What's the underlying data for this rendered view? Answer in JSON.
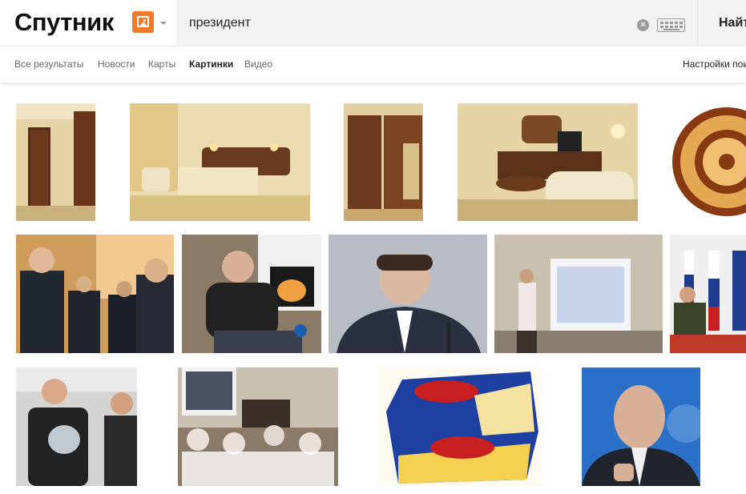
{
  "header": {
    "logo_text": "Спутник",
    "search_value": "президент",
    "search_button_label": "Найти",
    "clear_symbol": "×"
  },
  "nav": {
    "items": [
      "Все результаты",
      "Новости",
      "Карты",
      "Картинки",
      "Видео"
    ],
    "active_index": 3,
    "settings_label": "Настройки поиска"
  },
  "results": {
    "rows": [
      [
        {
          "subject": "hotel-room-door",
          "colors": [
            "#e8d8b0",
            "#5a2e18",
            "#c9b080"
          ]
        },
        {
          "subject": "hotel-bedroom",
          "colors": [
            "#efe0b8",
            "#6a3a20",
            "#e6d6a8"
          ]
        },
        {
          "subject": "wardrobe",
          "colors": [
            "#e2cfa0",
            "#6b3a1c",
            "#d8c08a"
          ]
        },
        {
          "subject": "hotel-living-room",
          "colors": [
            "#e8d8a8",
            "#5c3218",
            "#f0e6cc"
          ]
        },
        {
          "subject": "ornamental-rosette",
          "colors": [
            "#ffffff",
            "#8a3a12",
            "#e2a050"
          ]
        }
      ],
      [
        {
          "subject": "summit-leaders",
          "colors": [
            "#d0a060",
            "#222830",
            "#f0c890"
          ]
        },
        {
          "subject": "man-by-fireplace",
          "colors": [
            "#8a7a66",
            "#222222",
            "#f0a040"
          ]
        },
        {
          "subject": "man-at-microphone",
          "colors": [
            "#b8bcc4",
            "#2a3040",
            "#d8b8a0"
          ]
        },
        {
          "subject": "presentation-screen",
          "colors": [
            "#c8c0ae",
            "#ffffff",
            "#4a3a30"
          ]
        },
        {
          "subject": "flags-press-conference",
          "colors": [
            "#f0f0f0",
            "#c82020",
            "#203c90"
          ]
        }
      ],
      [
        {
          "subject": "award-ceremony",
          "colors": [
            "#d8d8d8",
            "#222222",
            "#c0c8d0"
          ]
        },
        {
          "subject": "audience-watching-screen",
          "colors": [
            "#c8c0b0",
            "#3a3028",
            "#f0f0f0"
          ]
        },
        {
          "subject": "cheese-package",
          "colors": [
            "#fffaf0",
            "#1e40a0",
            "#f4d050"
          ]
        },
        {
          "subject": "man-portrait-blue",
          "colors": [
            "#2a70c8",
            "#20242c",
            "#d8b098"
          ]
        }
      ]
    ]
  }
}
